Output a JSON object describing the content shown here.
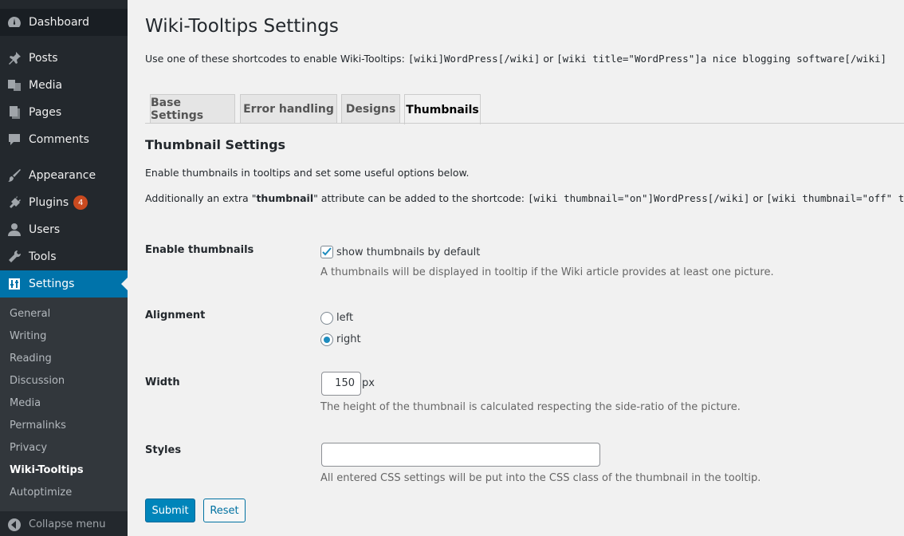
{
  "sidebar": {
    "items": [
      {
        "label": "Dashboard",
        "icon": "dashboard-icon"
      },
      {
        "label": "Posts",
        "icon": "pin-icon"
      },
      {
        "label": "Media",
        "icon": "media-icon"
      },
      {
        "label": "Pages",
        "icon": "pages-icon"
      },
      {
        "label": "Comments",
        "icon": "comment-icon"
      },
      {
        "label": "Appearance",
        "icon": "brush-icon"
      },
      {
        "label": "Plugins",
        "icon": "plug-icon",
        "badge": "4"
      },
      {
        "label": "Users",
        "icon": "user-icon"
      },
      {
        "label": "Tools",
        "icon": "wrench-icon"
      },
      {
        "label": "Settings",
        "icon": "settings-icon"
      }
    ],
    "submenu": [
      "General",
      "Writing",
      "Reading",
      "Discussion",
      "Media",
      "Permalinks",
      "Privacy",
      "Wiki-Tooltips",
      "Autoptimize"
    ],
    "collapse_label": "Collapse menu"
  },
  "page": {
    "title": "Wiki-Tooltips Settings",
    "intro_text": "Use one of these shortcodes to enable Wiki-Tooltips: ",
    "intro_code1": "[wiki]WordPress[/wiki]",
    "intro_or": " or ",
    "intro_code2": "[wiki title=\"WordPress\"]a nice blogging software[/wiki]"
  },
  "tabs": [
    "Base Settings",
    "Error handling",
    "Designs",
    "Thumbnails"
  ],
  "section": {
    "title": "Thumbnail Settings",
    "desc1": "Enable thumbnails in tooltips and set some useful options below.",
    "desc2_pre": "Additionally an extra \"",
    "desc2_bold": "thumbnail",
    "desc2_mid": "\" attribute can be added to the shortcode: ",
    "desc2_code1": "[wiki thumbnail=\"on\"]WordPress[/wiki]",
    "desc2_or": " or ",
    "desc2_code2": "[wiki thumbnail=\"off\" title="
  },
  "fields": {
    "enable_label": "Enable thumbnails",
    "enable_option": "show thumbnails by default",
    "enable_help": "A thumbnails will be displayed in tooltip if the Wiki article provides at least one picture.",
    "alignment_label": "Alignment",
    "align_left": "left",
    "align_right": "right",
    "width_label": "Width",
    "width_value": "150",
    "width_unit": "px",
    "width_help": "The height of the thumbnail is calculated respecting the side-ratio of the picture.",
    "styles_label": "Styles",
    "styles_value": "",
    "styles_help": "All entered CSS settings will be put into the CSS class of the thumbnail in the tooltip."
  },
  "buttons": {
    "submit": "Submit",
    "reset": "Reset"
  }
}
